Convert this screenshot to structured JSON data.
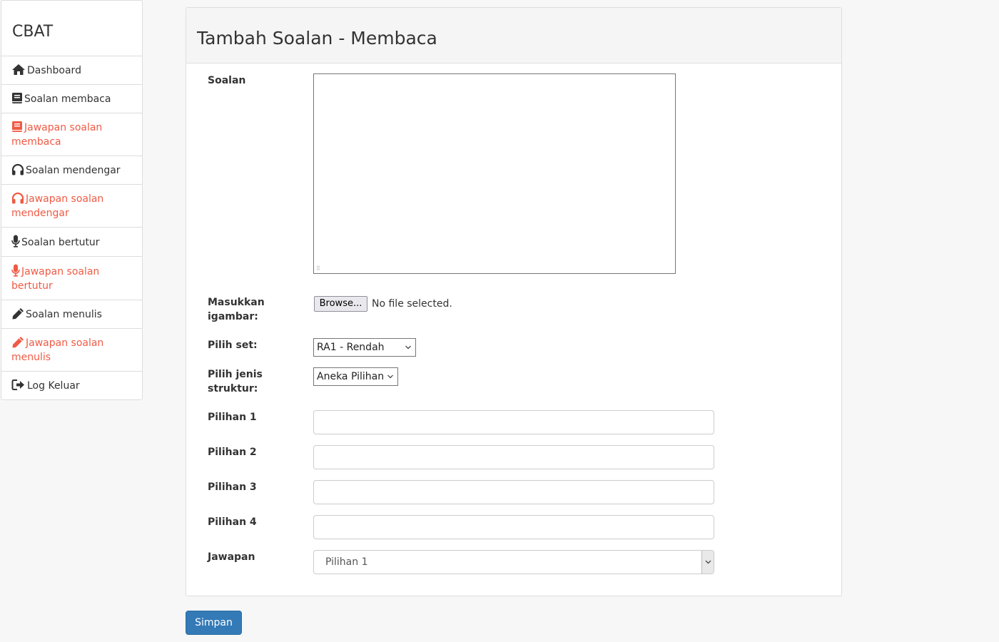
{
  "sidebar": {
    "brand": "CBAT",
    "items": [
      {
        "label": "Dashboard",
        "icon": "home-icon"
      },
      {
        "label": "Soalan membaca",
        "icon": "book-icon"
      },
      {
        "label": "Jawapan soalan membaca",
        "icon": "book-icon"
      },
      {
        "label": "Soalan mendengar",
        "icon": "headphones-icon"
      },
      {
        "label": "Jawapan soalan mendengar",
        "icon": "headphones-icon"
      },
      {
        "label": "Soalan bertutur",
        "icon": "microphone-icon"
      },
      {
        "label": "Jawapan soalan bertutur",
        "icon": "microphone-icon"
      },
      {
        "label": "Soalan menulis",
        "icon": "pencil-icon"
      },
      {
        "label": "Jawapan soalan menulis",
        "icon": "pencil-icon"
      },
      {
        "label": "Log Keluar",
        "icon": "logout-icon"
      }
    ],
    "accent_color": "#f05a44"
  },
  "form": {
    "title": "Tambah Soalan - Membaca",
    "soalan_label": "Soalan",
    "soalan_value": "",
    "gambar_label": "Masukkan igambar:",
    "browse_label": "Browse...",
    "file_status": "No file selected.",
    "set_label": "Pilih set:",
    "set_value": "RA1 - Rendah",
    "struktur_label": "Pilih jenis struktur:",
    "struktur_value": "Aneka Pilihan",
    "pilihan1_label": "Pilihan 1",
    "pilihan2_label": "Pilihan 2",
    "pilihan3_label": "Pilihan 3",
    "pilihan4_label": "Pilihan 4",
    "jawapan_label": "Jawapan",
    "jawapan_value": "Pilihan 1",
    "save_label": "Simpan",
    "save_color": "#337ab7"
  }
}
